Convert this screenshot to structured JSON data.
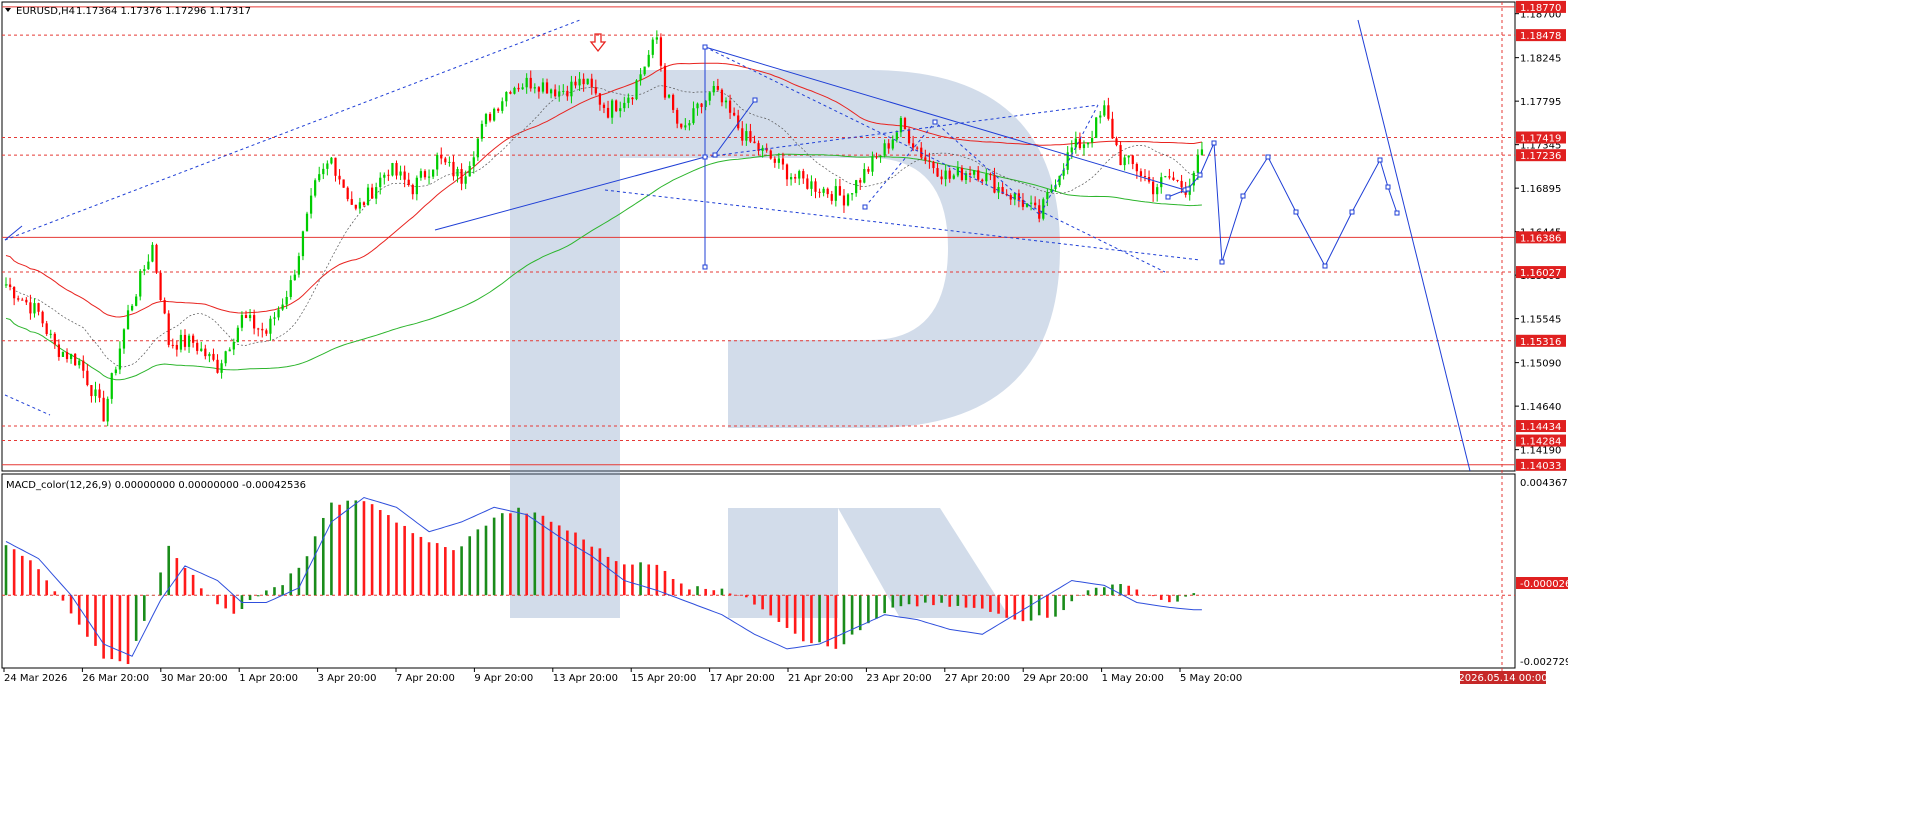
{
  "header": {
    "symbol": "EURUSD,H4",
    "ohlc": "1.17364 1.17376 1.17296 1.17317"
  },
  "colors": {
    "bull": "#00cc00",
    "bear": "#ff0000",
    "ma_red": "#e8231f",
    "ma_green": "#2db52d",
    "forecast": "#1f3fd6",
    "level": "#e53935",
    "macd_up": "#1a8c1a",
    "macd_down": "#ff1a1a",
    "signal": "#2f4fdc",
    "watermark": "#b8c8de"
  },
  "chart_data": [
    {
      "type": "candlestick",
      "title": "EURUSD,H4",
      "price_axis_ticks": [
        "1.18700",
        "1.18245",
        "1.17795",
        "1.17345",
        "1.16895",
        "1.16445",
        "1.15995",
        "1.15545",
        "1.15090",
        "1.14640",
        "1.14190"
      ],
      "horizontal_levels": [
        {
          "value": "1.18770",
          "style": "solid"
        },
        {
          "value": "1.18478",
          "style": "dashed"
        },
        {
          "value": "1.17419",
          "style": "dashed"
        },
        {
          "value": "1.17236",
          "style": "dashed"
        },
        {
          "value": "1.16386",
          "style": "solid"
        },
        {
          "value": "1.16027",
          "style": "dashed"
        },
        {
          "value": "1.15316",
          "style": "dashed"
        },
        {
          "value": "1.14434",
          "style": "dashed"
        },
        {
          "value": "1.14284",
          "style": "dashed"
        },
        {
          "value": "1.14033",
          "style": "solid"
        }
      ],
      "x_labels": [
        "24 Mar 2026",
        "26 Mar 20:00",
        "30 Mar 20:00",
        "1 Apr 20:00",
        "3 Apr 20:00",
        "7 Apr 20:00",
        "9 Apr 20:00",
        "13 Apr 20:00",
        "15 Apr 20:00",
        "17 Apr 20:00",
        "21 Apr 20:00",
        "23 Apr 20:00",
        "27 Apr 20:00",
        "29 Apr 20:00",
        "1 May 20:00",
        "5 May 20:00"
      ],
      "time_cursor_label": "2026.05.14 00:00",
      "ylim": [
        1.14,
        1.188
      ],
      "close_anchors": [
        [
          0,
          1.159
        ],
        [
          8,
          1.156
        ],
        [
          12,
          1.1525
        ],
        [
          18,
          1.151
        ],
        [
          24,
          1.1455
        ],
        [
          30,
          1.156
        ],
        [
          36,
          1.163
        ],
        [
          40,
          1.153
        ],
        [
          46,
          1.153
        ],
        [
          52,
          1.1505
        ],
        [
          58,
          1.1555
        ],
        [
          64,
          1.154
        ],
        [
          70,
          1.159
        ],
        [
          76,
          1.169
        ],
        [
          80,
          1.172
        ],
        [
          86,
          1.1665
        ],
        [
          94,
          1.171
        ],
        [
          100,
          1.169
        ],
        [
          106,
          1.172
        ],
        [
          112,
          1.17
        ],
        [
          118,
          1.176
        ],
        [
          124,
          1.1795
        ],
        [
          130,
          1.18
        ],
        [
          136,
          1.179
        ],
        [
          142,
          1.18
        ],
        [
          148,
          1.177
        ],
        [
          154,
          1.179
        ],
        [
          160,
          1.1845
        ],
        [
          162,
          1.179
        ],
        [
          166,
          1.1745
        ],
        [
          170,
          1.177
        ],
        [
          174,
          1.179
        ],
        [
          178,
          1.1765
        ],
        [
          182,
          1.174
        ],
        [
          188,
          1.172
        ],
        [
          194,
          1.17
        ],
        [
          200,
          1.169
        ],
        [
          206,
          1.168
        ],
        [
          210,
          1.17
        ],
        [
          216,
          1.173
        ],
        [
          220,
          1.1755
        ],
        [
          226,
          1.172
        ],
        [
          232,
          1.17
        ],
        [
          238,
          1.171
        ],
        [
          244,
          1.169
        ],
        [
          250,
          1.1675
        ],
        [
          254,
          1.166
        ],
        [
          258,
          1.17
        ],
        [
          262,
          1.173
        ],
        [
          266,
          1.174
        ],
        [
          270,
          1.177
        ],
        [
          274,
          1.172
        ],
        [
          278,
          1.171
        ],
        [
          282,
          1.169
        ],
        [
          286,
          1.17
        ],
        [
          290,
          1.169
        ],
        [
          294,
          1.1725
        ]
      ],
      "macd": {
        "label": "MACD_color(12,26,9) 0.00000000 0.00000000 -0.00042536",
        "axis_ticks": [
          "0.0043673",
          "-0.000026",
          "-0.0027294"
        ],
        "ylim": [
          -0.0029,
          0.0048
        ],
        "hist_anchors": [
          [
            0,
            0.002
          ],
          [
            6,
            0.0015
          ],
          [
            14,
            -0.0003
          ],
          [
            24,
            -0.0025
          ],
          [
            30,
            -0.0029
          ],
          [
            36,
            0.0
          ],
          [
            40,
            0.002
          ],
          [
            44,
            0.0012
          ],
          [
            50,
            -0.0001
          ],
          [
            56,
            -0.0007
          ],
          [
            62,
            0.0
          ],
          [
            68,
            0.0004
          ],
          [
            74,
            0.0016
          ],
          [
            80,
            0.0038
          ],
          [
            90,
            0.0038
          ],
          [
            100,
            0.0025
          ],
          [
            110,
            0.0018
          ],
          [
            120,
            0.0032
          ],
          [
            126,
            0.0035
          ],
          [
            132,
            0.0032
          ],
          [
            140,
            0.0025
          ],
          [
            150,
            0.0014
          ],
          [
            160,
            0.0012
          ],
          [
            168,
            0.0003
          ],
          [
            176,
            0.0003
          ],
          [
            186,
            -0.0005
          ],
          [
            196,
            -0.0018
          ],
          [
            204,
            -0.0022
          ],
          [
            212,
            -0.0012
          ],
          [
            220,
            -0.0004
          ],
          [
            230,
            -0.0004
          ],
          [
            240,
            -0.0006
          ],
          [
            250,
            -0.001
          ],
          [
            258,
            -0.0008
          ],
          [
            266,
            0.0002
          ],
          [
            272,
            0.0005
          ],
          [
            280,
            0.0001
          ],
          [
            286,
            -0.0003
          ],
          [
            292,
            0.0
          ]
        ],
        "signal_anchors": [
          [
            0,
            0.0022
          ],
          [
            8,
            0.0015
          ],
          [
            16,
            0.0
          ],
          [
            24,
            -0.002
          ],
          [
            31,
            -0.0025
          ],
          [
            38,
            -0.0002
          ],
          [
            44,
            0.0012
          ],
          [
            52,
            0.0006
          ],
          [
            58,
            -0.0003
          ],
          [
            64,
            -0.0003
          ],
          [
            72,
            0.0003
          ],
          [
            80,
            0.003
          ],
          [
            88,
            0.004
          ],
          [
            96,
            0.0036
          ],
          [
            104,
            0.0026
          ],
          [
            112,
            0.003
          ],
          [
            120,
            0.0036
          ],
          [
            128,
            0.0033
          ],
          [
            136,
            0.0024
          ],
          [
            144,
            0.0016
          ],
          [
            152,
            0.0006
          ],
          [
            160,
            0.0002
          ],
          [
            168,
            -0.0003
          ],
          [
            176,
            -0.0008
          ],
          [
            184,
            -0.0016
          ],
          [
            192,
            -0.0022
          ],
          [
            200,
            -0.002
          ],
          [
            208,
            -0.0014
          ],
          [
            216,
            -0.0008
          ],
          [
            224,
            -0.001
          ],
          [
            232,
            -0.0014
          ],
          [
            240,
            -0.0016
          ],
          [
            248,
            -0.0008
          ],
          [
            256,
            0.0
          ],
          [
            262,
            0.0006
          ],
          [
            270,
            0.0004
          ],
          [
            278,
            -0.0003
          ],
          [
            286,
            -0.0005
          ],
          [
            292,
            -0.0006
          ]
        ]
      }
    }
  ]
}
